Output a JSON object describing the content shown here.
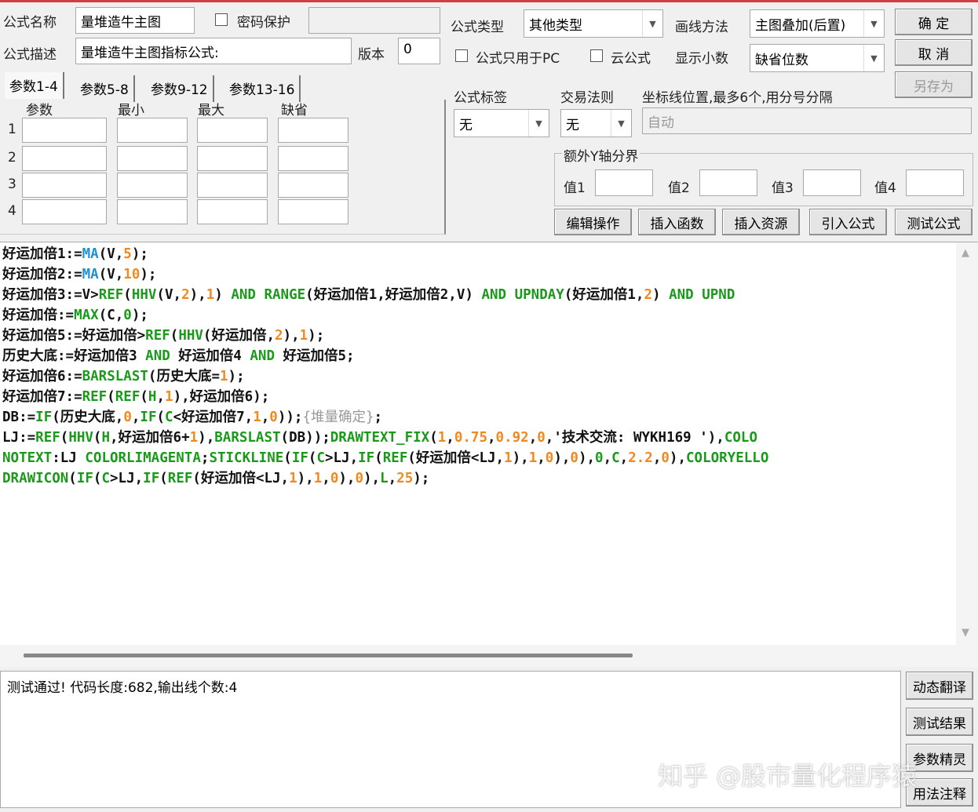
{
  "form": {
    "name_label": "公式名称",
    "name_value": "量堆造牛主图",
    "password_label": "密码保护",
    "desc_label": "公式描述",
    "desc_value": "量堆造牛主图指标公式:",
    "version_label": "版本",
    "version_value": "0",
    "type_label": "公式类型",
    "type_value": "其他类型",
    "draw_label": "画线方法",
    "draw_value": "主图叠加(后置)",
    "pc_only_label": "公式只用于PC",
    "cloud_label": "云公式",
    "decimals_label": "显示小数",
    "decimals_value": "缺省位数",
    "tag_label": "公式标签",
    "tag_value": "无",
    "rule_label": "交易法则",
    "rule_value": "无",
    "axis_label": "坐标线位置,最多6个,用分号分隔",
    "axis_placeholder": "自动",
    "yaxis_group": "额外Y轴分界",
    "y_labels": [
      "值1",
      "值2",
      "值3",
      "值4"
    ]
  },
  "buttons": {
    "ok": "确  定",
    "cancel": "取  消",
    "save_as": "另存为",
    "tools": [
      "编辑操作",
      "插入函数",
      "插入资源",
      "引入公式",
      "测试公式"
    ],
    "side": [
      "动态翻译",
      "测试结果",
      "参数精灵",
      "用法注释"
    ]
  },
  "params": {
    "tabs": [
      "参数1-4",
      "参数5-8",
      "参数9-12",
      "参数13-16"
    ],
    "headers": [
      "参数",
      "最小",
      "最大",
      "缺省"
    ],
    "rows": [
      "1",
      "2",
      "3",
      "4"
    ]
  },
  "code_lines": [
    [
      [
        "d",
        "好运加倍1:="
      ],
      [
        "f",
        "MA"
      ],
      [
        "d",
        "(V,"
      ],
      [
        "n",
        "5"
      ],
      [
        "d",
        ");"
      ]
    ],
    [
      [
        "d",
        "好运加倍2:="
      ],
      [
        "f",
        "MA"
      ],
      [
        "d",
        "(V,"
      ],
      [
        "n",
        "10"
      ],
      [
        "d",
        ");"
      ]
    ],
    [
      [
        "d",
        "好运加倍3:=V>"
      ],
      [
        "k",
        "REF"
      ],
      [
        "d",
        "("
      ],
      [
        "k",
        "HHV"
      ],
      [
        "d",
        "(V,"
      ],
      [
        "n",
        "2"
      ],
      [
        "d",
        "),"
      ],
      [
        "n",
        "1"
      ],
      [
        "d",
        ") "
      ],
      [
        "k",
        "AND"
      ],
      [
        "d",
        " "
      ],
      [
        "k",
        "RANGE"
      ],
      [
        "d",
        "(好运加倍1,好运加倍2,V) "
      ],
      [
        "k",
        "AND"
      ],
      [
        "d",
        " "
      ],
      [
        "k",
        "UPNDAY"
      ],
      [
        "d",
        "(好运加倍1,"
      ],
      [
        "n",
        "2"
      ],
      [
        "d",
        ") "
      ],
      [
        "k",
        "AND"
      ],
      [
        "d",
        " "
      ],
      [
        "k",
        "UPND"
      ]
    ],
    [
      [
        "d",
        "好运加倍:="
      ],
      [
        "k",
        "MAX"
      ],
      [
        "d",
        "(C,"
      ],
      [
        "k",
        "0"
      ],
      [
        "d",
        ");"
      ]
    ],
    [
      [
        "d",
        "好运加倍5:=好运加倍>"
      ],
      [
        "k",
        "REF"
      ],
      [
        "d",
        "("
      ],
      [
        "k",
        "HHV"
      ],
      [
        "d",
        "(好运加倍,"
      ],
      [
        "n",
        "2"
      ],
      [
        "d",
        "),"
      ],
      [
        "n",
        "1"
      ],
      [
        "d",
        ");"
      ]
    ],
    [
      [
        "d",
        "历史大底:=好运加倍3 "
      ],
      [
        "k",
        "AND"
      ],
      [
        "d",
        " 好运加倍4 "
      ],
      [
        "k",
        "AND"
      ],
      [
        "d",
        " 好运加倍5;"
      ]
    ],
    [
      [
        "d",
        "好运加倍6:="
      ],
      [
        "k",
        "BARSLAST"
      ],
      [
        "d",
        "(历史大底="
      ],
      [
        "n",
        "1"
      ],
      [
        "d",
        ");"
      ]
    ],
    [
      [
        "d",
        "好运加倍7:="
      ],
      [
        "k",
        "REF"
      ],
      [
        "d",
        "("
      ],
      [
        "k",
        "REF"
      ],
      [
        "d",
        "("
      ],
      [
        "k",
        "H"
      ],
      [
        "d",
        ","
      ],
      [
        "n",
        "1"
      ],
      [
        "d",
        "),好运加倍6);"
      ]
    ],
    [
      [
        "d",
        "DB:="
      ],
      [
        "k",
        "IF"
      ],
      [
        "d",
        "(历史大底,"
      ],
      [
        "n",
        "0"
      ],
      [
        "d",
        ","
      ],
      [
        "k",
        "IF"
      ],
      [
        "d",
        "("
      ],
      [
        "k",
        "C"
      ],
      [
        "d",
        "<好运加倍7,"
      ],
      [
        "n",
        "1"
      ],
      [
        "d",
        ","
      ],
      [
        "n",
        "0"
      ],
      [
        "d",
        "));"
      ],
      [
        "c",
        "{堆量确定}"
      ],
      [
        "d",
        ";"
      ]
    ],
    [
      [
        "d",
        "LJ:="
      ],
      [
        "k",
        "REF"
      ],
      [
        "d",
        "("
      ],
      [
        "k",
        "HHV"
      ],
      [
        "d",
        "("
      ],
      [
        "k",
        "H"
      ],
      [
        "d",
        ",好运加倍6+"
      ],
      [
        "n",
        "1"
      ],
      [
        "d",
        "),"
      ],
      [
        "k",
        "BARSLAST"
      ],
      [
        "d",
        "(DB));"
      ],
      [
        "k",
        "DRAWTEXT_FIX"
      ],
      [
        "d",
        "("
      ],
      [
        "n",
        "1"
      ],
      [
        "d",
        ","
      ],
      [
        "n",
        "0.75"
      ],
      [
        "d",
        ","
      ],
      [
        "n",
        "0.92"
      ],
      [
        "d",
        ","
      ],
      [
        "n",
        "0"
      ],
      [
        "d",
        ",'技术交流: WYKH169 '),"
      ],
      [
        "k",
        "COLO"
      ]
    ],
    [
      [
        "k",
        "NOTEXT"
      ],
      [
        "d",
        ":LJ "
      ],
      [
        "k",
        "COLORLIMAGENTA"
      ],
      [
        "d",
        ";"
      ],
      [
        "k",
        "STICKLINE"
      ],
      [
        "d",
        "("
      ],
      [
        "k",
        "IF"
      ],
      [
        "d",
        "("
      ],
      [
        "k",
        "C"
      ],
      [
        "d",
        ">LJ,"
      ],
      [
        "k",
        "IF"
      ],
      [
        "d",
        "("
      ],
      [
        "k",
        "REF"
      ],
      [
        "d",
        "(好运加倍<LJ,"
      ],
      [
        "n",
        "1"
      ],
      [
        "d",
        "),"
      ],
      [
        "n",
        "1"
      ],
      [
        "d",
        ","
      ],
      [
        "n",
        "0"
      ],
      [
        "d",
        "),"
      ],
      [
        "n",
        "0"
      ],
      [
        "d",
        "),"
      ],
      [
        "k",
        "0"
      ],
      [
        "d",
        ","
      ],
      [
        "k",
        "C"
      ],
      [
        "d",
        ","
      ],
      [
        "n",
        "2.2"
      ],
      [
        "d",
        ","
      ],
      [
        "n",
        "0"
      ],
      [
        "d",
        "),"
      ],
      [
        "k",
        "COLORYELLO"
      ]
    ],
    [
      [
        "k",
        "DRAWICON"
      ],
      [
        "d",
        "("
      ],
      [
        "k",
        "IF"
      ],
      [
        "d",
        "("
      ],
      [
        "k",
        "C"
      ],
      [
        "d",
        ">LJ,"
      ],
      [
        "k",
        "IF"
      ],
      [
        "d",
        "("
      ],
      [
        "k",
        "REF"
      ],
      [
        "d",
        "(好运加倍<LJ,"
      ],
      [
        "n",
        "1"
      ],
      [
        "d",
        "),"
      ],
      [
        "n",
        "1"
      ],
      [
        "d",
        ","
      ],
      [
        "n",
        "0"
      ],
      [
        "d",
        "),"
      ],
      [
        "n",
        "0"
      ],
      [
        "d",
        "),"
      ],
      [
        "k",
        "L"
      ],
      [
        "d",
        ","
      ],
      [
        "n",
        "25"
      ],
      [
        "d",
        ");"
      ]
    ]
  ],
  "output_text": "测试通过! 代码长度:682,输出线个数:4",
  "watermark": "知乎 @股市量化程序猿",
  "icons": {
    "dropdown": "chevron-down-icon",
    "scroll_up": "triangle-up-icon",
    "scroll_down": "triangle-down-icon"
  }
}
